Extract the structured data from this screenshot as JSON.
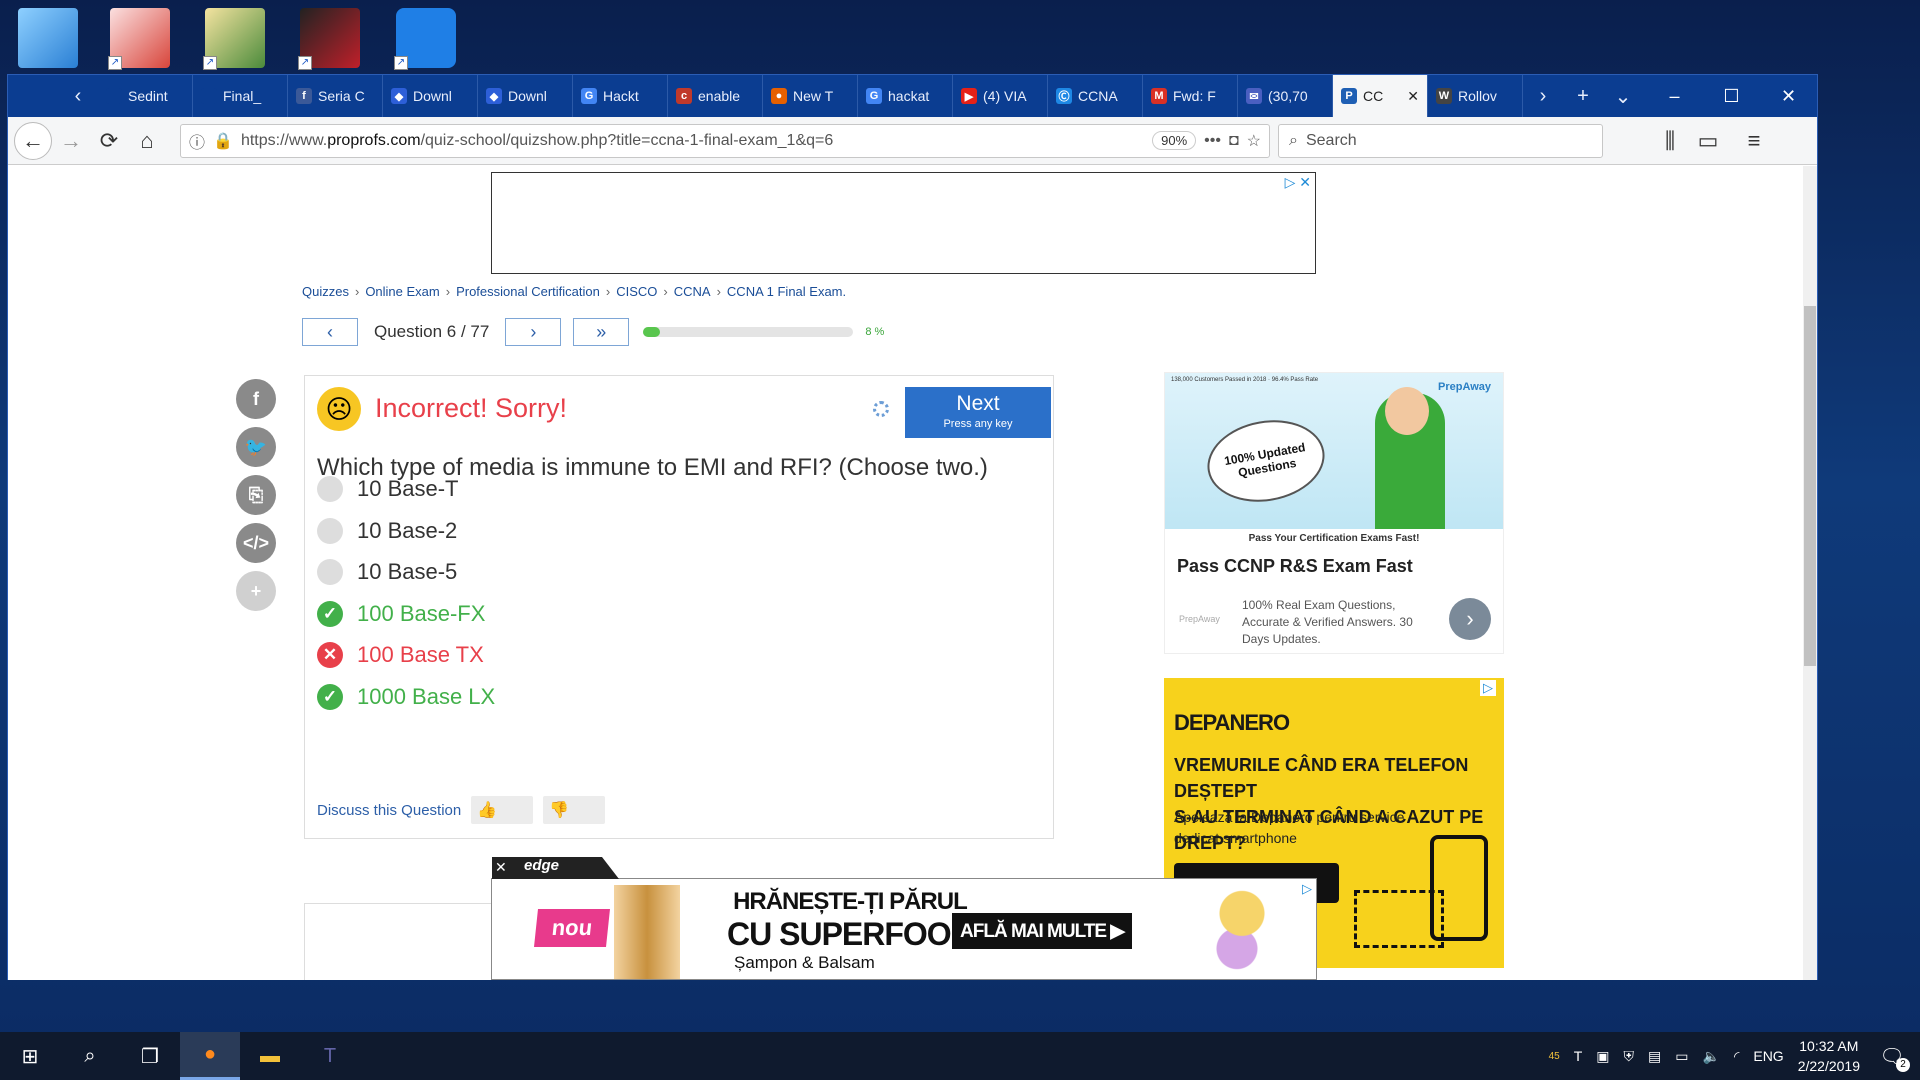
{
  "browser": {
    "tabs": [
      {
        "label": "Sedint",
        "fav": "",
        "color": "#0b3d91"
      },
      {
        "label": "Final_",
        "fav": "",
        "color": "#0b3d91"
      },
      {
        "label": "Seria C",
        "fav": "f",
        "color": "#3b5998"
      },
      {
        "label": "Downl",
        "fav": "◆",
        "color": "#2d5fd8"
      },
      {
        "label": "Downl",
        "fav": "◆",
        "color": "#2d5fd8"
      },
      {
        "label": "Hackt",
        "fav": "G",
        "color": "#4285f4"
      },
      {
        "label": "enable",
        "fav": "c",
        "color": "#c0392b"
      },
      {
        "label": "New T",
        "fav": "●",
        "color": "#e66000"
      },
      {
        "label": "hackat",
        "fav": "G",
        "color": "#4285f4"
      },
      {
        "label": "(4) VIA",
        "fav": "▶",
        "color": "#e62117"
      },
      {
        "label": "CCNA",
        "fav": "Ⓒ",
        "color": "#1e88e5"
      },
      {
        "label": "Fwd: F",
        "fav": "M",
        "color": "#d93025"
      },
      {
        "label": "(30,70",
        "fav": "✉",
        "color": "#4a5fc1"
      },
      {
        "label": "CC",
        "fav": "P",
        "color": "#1e5fb4"
      },
      {
        "label": "Rollov",
        "fav": "W",
        "color": "#444"
      }
    ],
    "url_prefix": "https://www.",
    "url_domain": "proprofs.com",
    "url_path": "/quiz-school/quizshow.php?title=ccna-1-final-exam_1&q=6",
    "zoom": "90%",
    "search_placeholder": "Search"
  },
  "breadcrumb": [
    "Quizzes",
    "Online Exam",
    "Professional Certification",
    "CISCO",
    "CCNA",
    "CCNA 1 Final Exam."
  ],
  "quiz": {
    "question_label": "Question 6 / 77",
    "progress_fraction": 0.08,
    "progress_text": "8 %",
    "result": "Incorrect! Sorry!",
    "next_label": "Next",
    "next_hint": "Press any key",
    "question": "Which type of media is immune to EMI and RFI? (Choose two.)",
    "options": [
      {
        "text": "10 Base-T",
        "state": "none"
      },
      {
        "text": "10 Base-2",
        "state": "none"
      },
      {
        "text": "10 Base-5",
        "state": "none"
      },
      {
        "text": "100 Base-FX",
        "state": "correct"
      },
      {
        "text": "100 Base TX",
        "state": "wrong"
      },
      {
        "text": "1000 Base LX",
        "state": "correct"
      }
    ],
    "discuss": "Discuss this Question"
  },
  "ads": {
    "prepaway_top": "138,000 Customers Passed in 2018 · 96.4% Pass Rate",
    "prepaway_brand": "PrepAway",
    "prepaway_burst": "100% Updated Questions",
    "prepaway_tagline": "Pass Your Certification Exams Fast!",
    "prepaway_title": "Pass CCNP R&S Exam Fast",
    "prepaway_logo": "PrepAway",
    "prepaway_desc": "100% Real Exam Questions, Accurate & Verified Answers. 30 Days Updates.",
    "depanero_logo": "DEPANERO",
    "depanero_headline_1": "VREMURILE CÂND ERA TELEFON DEȘTEPT",
    "depanero_headline_2": "S-AU TERMINAT CÂND A CAZUT PE DREPT?",
    "depanero_sub": "Apelează la Depanero pentru service dedicat smartphone",
    "edge_label": "edge",
    "pantene_nou": "nou",
    "pantene_h1": "HRĂNEȘTE-ȚI PĂRUL",
    "pantene_h1b": "CU SUPERFOOD",
    "pantene_h2": "Șampon & Balsam",
    "pantene_cta": "AFLĂ MAI MULTE ▶"
  },
  "taskbar": {
    "tray_count": "45",
    "lang": "ENG",
    "time": "10:32 AM",
    "date": "2/22/2019",
    "notifications": "2"
  }
}
